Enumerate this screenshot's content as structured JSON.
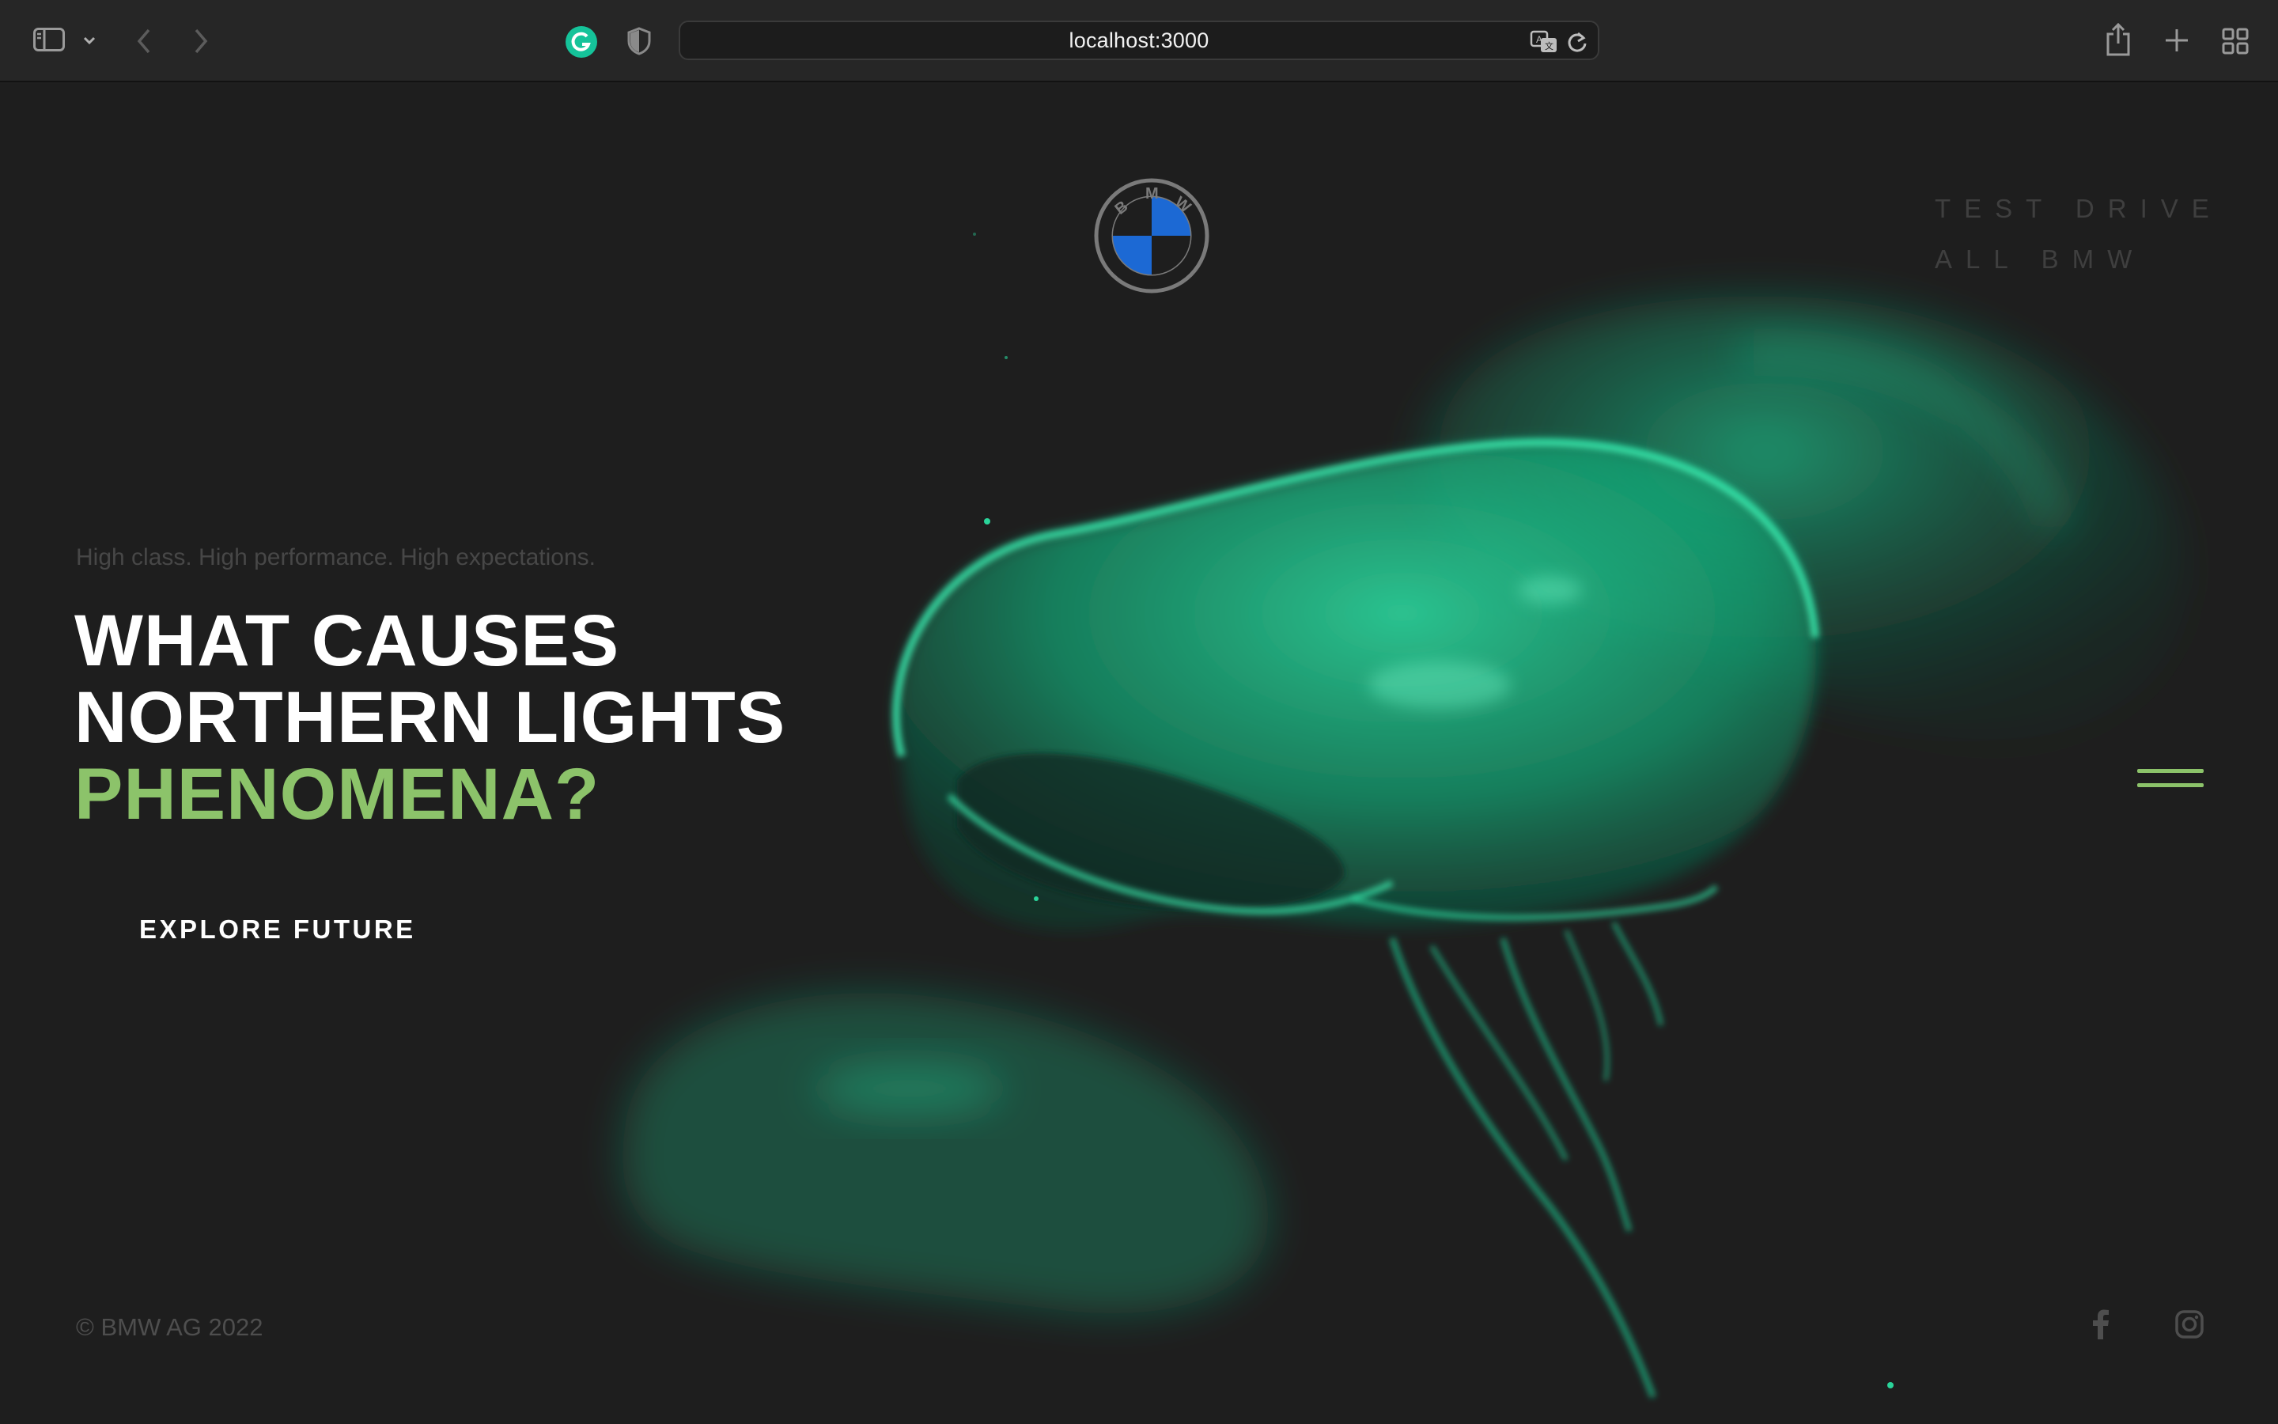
{
  "browser": {
    "url": "localhost:3000",
    "icons": {
      "sidebar": "sidebar-icon",
      "chevron": "chevron-down-icon",
      "back": "back-arrow-icon",
      "forward": "forward-arrow-icon",
      "grammarly": "grammarly-icon",
      "privacy": "shield-icon",
      "translate": "translate-icon",
      "reload": "reload-icon",
      "share": "share-icon",
      "new_tab": "plus-icon",
      "tab_overview": "tab-grid-icon"
    }
  },
  "page": {
    "logo": {
      "letters": "BMW",
      "icon": "bmw-roundel-icon",
      "colors": {
        "blue": "#1c69d4",
        "ring": "#7a7a7a"
      }
    },
    "top_links": [
      "TEST DRIVE",
      "ALL BMW"
    ],
    "tagline": "High class. High performance. High expectations.",
    "headline": {
      "line1": "WHAT CAUSES",
      "line2": "NORTHERN LIGHTS",
      "line3": "PHENOMENA?"
    },
    "cta": "EXPLORE FUTURE",
    "menu_icon": "hamburger-menu-icon",
    "copyright": "© BMW AG 2022",
    "social": [
      "facebook-icon",
      "instagram-icon"
    ],
    "colors": {
      "background": "#1e1e1e",
      "accent": "#8cc36a",
      "glow": "#1fd69a"
    }
  }
}
